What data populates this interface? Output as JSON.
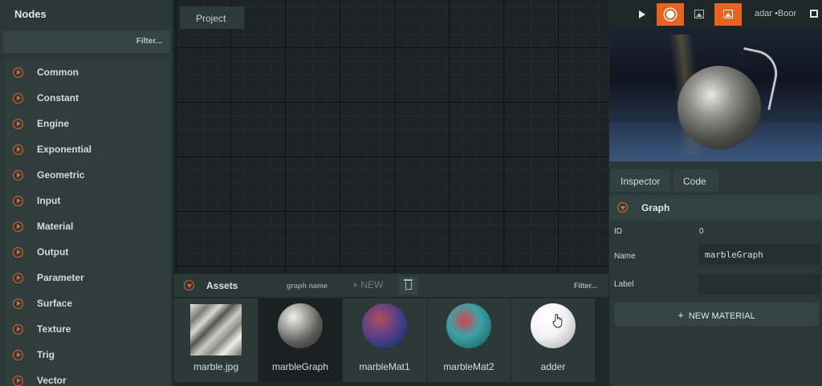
{
  "nodes_panel": {
    "title": "Nodes",
    "filter_placeholder": "Filter...",
    "items": [
      "Common",
      "Constant",
      "Engine",
      "Exponential",
      "Geometric",
      "Input",
      "Material",
      "Output",
      "Parameter",
      "Surface",
      "Texture",
      "Trig",
      "Vector"
    ]
  },
  "graph": {
    "project_tab": "Project"
  },
  "assets": {
    "title": "Assets",
    "graph_name_placeholder": "graph name",
    "new_label": "NEW",
    "filter_placeholder": "Filter...",
    "items": [
      {
        "label": "marble.jpg"
      },
      {
        "label": "marbleGraph"
      },
      {
        "label": "marbleMat1"
      },
      {
        "label": "marbleMat2"
      },
      {
        "label": "adder"
      }
    ]
  },
  "toolbar": {
    "text": "adar  •Boor",
    "accent_color": "#e8641e"
  },
  "inspector": {
    "tabs": [
      "Inspector",
      "Code"
    ],
    "section_title": "Graph",
    "id_label": "ID",
    "id_value": "0",
    "name_label": "Name",
    "name_value": "marbleGraph",
    "label_label": "Label",
    "label_value": "",
    "new_material_label": "NEW MATERIAL"
  }
}
